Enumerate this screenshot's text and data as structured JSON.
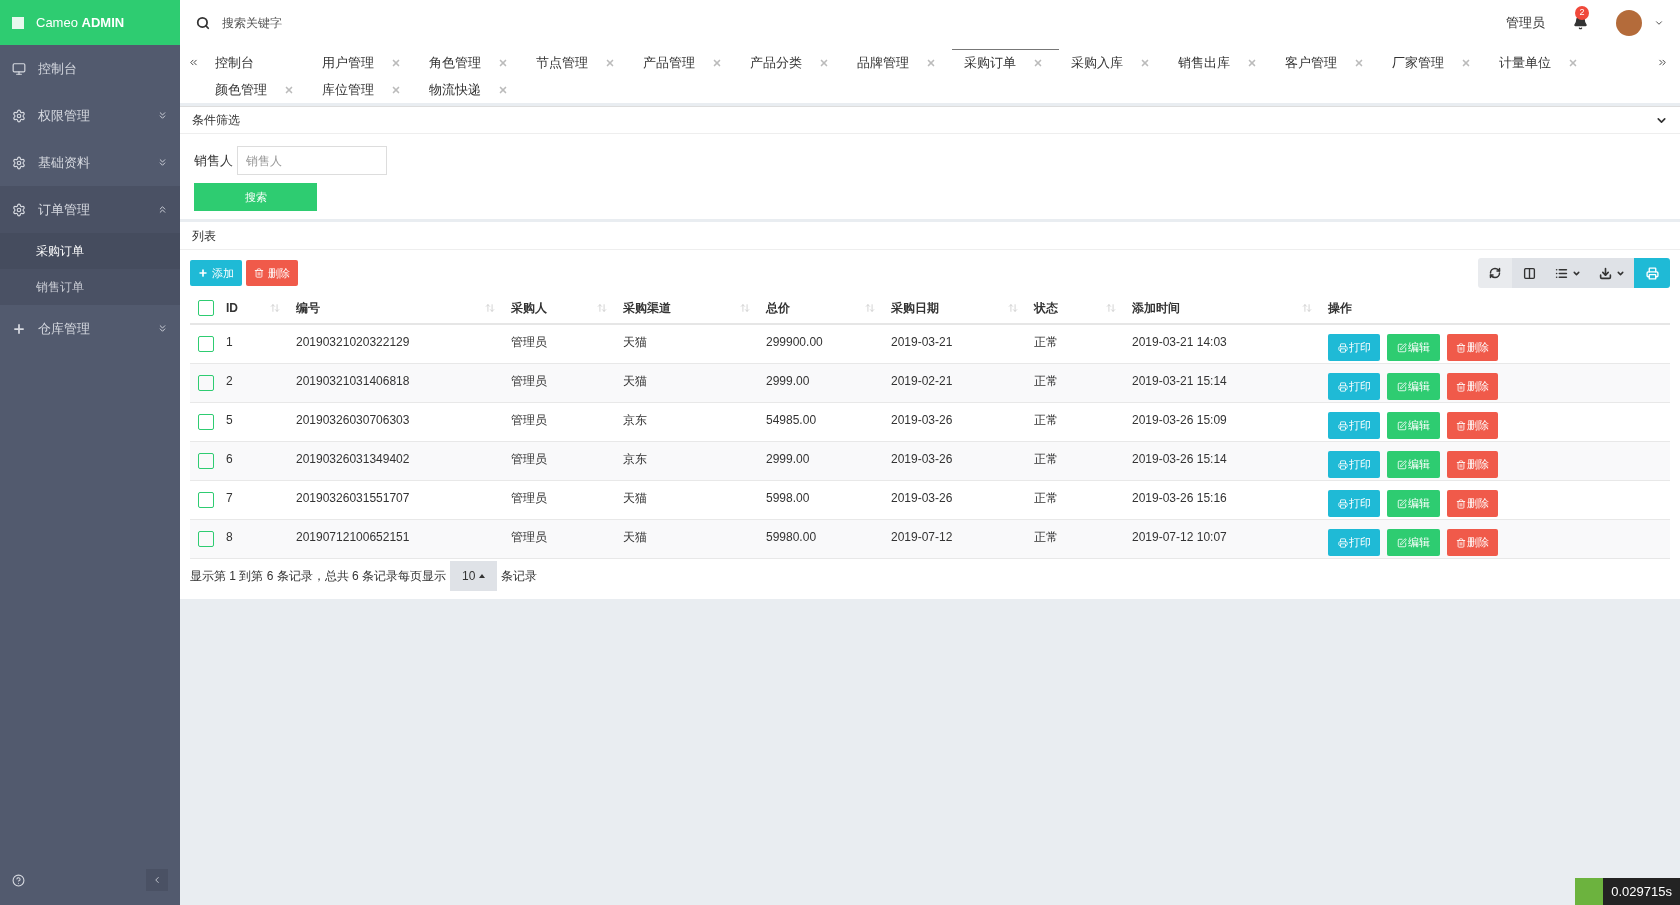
{
  "brand": {
    "name": "Cameo",
    "bold": "ADMIN"
  },
  "sidebar": {
    "items": [
      {
        "label": "控制台"
      },
      {
        "label": "权限管理",
        "expanded": false
      },
      {
        "label": "基础资料",
        "expanded": false
      },
      {
        "label": "订单管理",
        "expanded": true,
        "children": [
          {
            "label": "采购订单",
            "selected": true
          },
          {
            "label": "销售订单",
            "selected": false
          }
        ]
      },
      {
        "label": "仓库管理",
        "expanded": false
      }
    ]
  },
  "header": {
    "search_placeholder": "搜索关键字",
    "user": "管理员",
    "notifications": "2"
  },
  "tabs": [
    {
      "label": "控制台",
      "selected": false,
      "closable": false
    },
    {
      "label": "用户管理",
      "selected": false,
      "closable": true
    },
    {
      "label": "角色管理",
      "selected": false,
      "closable": true
    },
    {
      "label": "节点管理",
      "selected": false,
      "closable": true
    },
    {
      "label": "产品管理",
      "selected": false,
      "closable": true
    },
    {
      "label": "产品分类",
      "selected": false,
      "closable": true
    },
    {
      "label": "品牌管理",
      "selected": false,
      "closable": true
    },
    {
      "label": "采购订单",
      "selected": true,
      "closable": true
    },
    {
      "label": "采购入库",
      "selected": false,
      "closable": true
    },
    {
      "label": "销售出库",
      "selected": false,
      "closable": true
    },
    {
      "label": "客户管理",
      "selected": false,
      "closable": true
    },
    {
      "label": "厂家管理",
      "selected": false,
      "closable": true
    },
    {
      "label": "计量单位",
      "selected": false,
      "closable": true
    },
    {
      "label": "颜色管理",
      "selected": false,
      "closable": true
    },
    {
      "label": "库位管理",
      "selected": false,
      "closable": true
    },
    {
      "label": "物流快递",
      "selected": false,
      "closable": true
    }
  ],
  "select_all": {
    "checked": false
  },
  "filter": {
    "title": "条件筛选",
    "field_label": "销售人",
    "placeholder": "销售人",
    "button": "搜索"
  },
  "list": {
    "title": "列表",
    "add": "添加",
    "delete": "删除",
    "columns": [
      "ID",
      "编号",
      "采购人",
      "采购渠道",
      "总价",
      "采购日期",
      "状态",
      "添加时间",
      "操作"
    ],
    "rows": [
      {
        "checked": false,
        "cells": [
          "1",
          "20190321020322129",
          "管理员",
          "天猫",
          "299900.00",
          "2019-03-21",
          "正常",
          "2019-03-21 14:03"
        ],
        "actions": [
          "打印",
          "编辑",
          "删除"
        ]
      },
      {
        "checked": false,
        "cells": [
          "2",
          "20190321031406818",
          "管理员",
          "天猫",
          "2999.00",
          "2019-02-21",
          "正常",
          "2019-03-21 15:14"
        ],
        "actions": [
          "打印",
          "编辑",
          "删除"
        ]
      },
      {
        "checked": false,
        "cells": [
          "5",
          "20190326030706303",
          "管理员",
          "京东",
          "54985.00",
          "2019-03-26",
          "正常",
          "2019-03-26 15:09"
        ],
        "actions": [
          "打印",
          "编辑",
          "删除"
        ]
      },
      {
        "checked": false,
        "cells": [
          "6",
          "20190326031349402",
          "管理员",
          "京东",
          "2999.00",
          "2019-03-26",
          "正常",
          "2019-03-26 15:14"
        ],
        "actions": [
          "打印",
          "编辑",
          "删除"
        ]
      },
      {
        "checked": false,
        "cells": [
          "7",
          "20190326031551707",
          "管理员",
          "天猫",
          "5998.00",
          "2019-03-26",
          "正常",
          "2019-03-26 15:16"
        ],
        "actions": [
          "打印",
          "编辑",
          "删除"
        ]
      },
      {
        "checked": false,
        "cells": [
          "8",
          "20190712100652151",
          "管理员",
          "天猫",
          "59980.00",
          "2019-07-12",
          "正常",
          "2019-07-12 10:07"
        ],
        "actions": [
          "打印",
          "编辑",
          "删除"
        ]
      }
    ],
    "pagination": {
      "before": "显示第 1 到第 6 条记录，总共 6 条记录每页显示",
      "page_size": "10",
      "after": "条记录"
    }
  },
  "trace": "0.029715s"
}
